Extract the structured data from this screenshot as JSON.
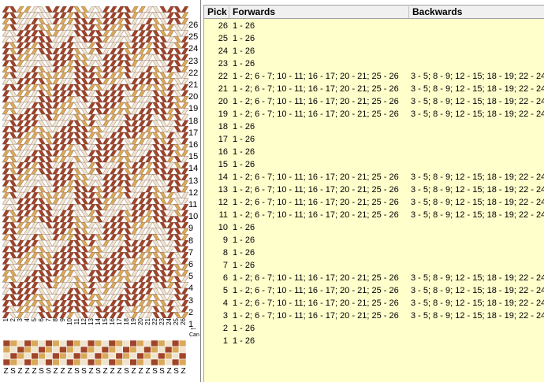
{
  "colors": {
    "rust": "#a0442a",
    "gold": "#d9a95a",
    "cream": "#efe4cf",
    "table_bg": "#ffffcc",
    "header_bg": "#f0f0f0"
  },
  "table": {
    "headers": {
      "pick": "Pick",
      "forwards": "Forwards",
      "backwards": "Backwards"
    },
    "rows": [
      {
        "pick": "26",
        "forwards": "1 - 26",
        "backwards": ""
      },
      {
        "pick": "25",
        "forwards": "1 - 26",
        "backwards": ""
      },
      {
        "pick": "24",
        "forwards": "1 - 26",
        "backwards": ""
      },
      {
        "pick": "23",
        "forwards": "1 - 26",
        "backwards": ""
      },
      {
        "pick": "22",
        "forwards": "1 - 2; 6 - 7; 10 - 11; 16 - 17; 20 - 21; 25 - 26",
        "backwards": "3 - 5; 8 - 9; 12 - 15; 18 - 19; 22 - 24"
      },
      {
        "pick": "21",
        "forwards": "1 - 2; 6 - 7; 10 - 11; 16 - 17; 20 - 21; 25 - 26",
        "backwards": "3 - 5; 8 - 9; 12 - 15; 18 - 19; 22 - 24"
      },
      {
        "pick": "20",
        "forwards": "1 - 2; 6 - 7; 10 - 11; 16 - 17; 20 - 21; 25 - 26",
        "backwards": "3 - 5; 8 - 9; 12 - 15; 18 - 19; 22 - 24"
      },
      {
        "pick": "19",
        "forwards": "1 - 2; 6 - 7; 10 - 11; 16 - 17; 20 - 21; 25 - 26",
        "backwards": "3 - 5; 8 - 9; 12 - 15; 18 - 19; 22 - 24"
      },
      {
        "pick": "18",
        "forwards": "1 - 26",
        "backwards": ""
      },
      {
        "pick": "17",
        "forwards": "1 - 26",
        "backwards": ""
      },
      {
        "pick": "16",
        "forwards": "1 - 26",
        "backwards": ""
      },
      {
        "pick": "15",
        "forwards": "1 - 26",
        "backwards": ""
      },
      {
        "pick": "14",
        "forwards": "1 - 2; 6 - 7; 10 - 11; 16 - 17; 20 - 21; 25 - 26",
        "backwards": "3 - 5; 8 - 9; 12 - 15; 18 - 19; 22 - 24"
      },
      {
        "pick": "13",
        "forwards": "1 - 2; 6 - 7; 10 - 11; 16 - 17; 20 - 21; 25 - 26",
        "backwards": "3 - 5; 8 - 9; 12 - 15; 18 - 19; 22 - 24"
      },
      {
        "pick": "12",
        "forwards": "1 - 2; 6 - 7; 10 - 11; 16 - 17; 20 - 21; 25 - 26",
        "backwards": "3 - 5; 8 - 9; 12 - 15; 18 - 19; 22 - 24"
      },
      {
        "pick": "11",
        "forwards": "1 - 2; 6 - 7; 10 - 11; 16 - 17; 20 - 21; 25 - 26",
        "backwards": "3 - 5; 8 - 9; 12 - 15; 18 - 19; 22 - 24"
      },
      {
        "pick": "10",
        "forwards": "1 - 26",
        "backwards": ""
      },
      {
        "pick": "9",
        "forwards": "1 - 26",
        "backwards": ""
      },
      {
        "pick": "8",
        "forwards": "1 - 26",
        "backwards": ""
      },
      {
        "pick": "7",
        "forwards": "1 - 26",
        "backwards": ""
      },
      {
        "pick": "6",
        "forwards": "1 - 2; 6 - 7; 10 - 11; 16 - 17; 20 - 21; 25 - 26",
        "backwards": "3 - 5; 8 - 9; 12 - 15; 18 - 19; 22 - 24"
      },
      {
        "pick": "5",
        "forwards": "1 - 2; 6 - 7; 10 - 11; 16 - 17; 20 - 21; 25 - 26",
        "backwards": "3 - 5; 8 - 9; 12 - 15; 18 - 19; 22 - 24"
      },
      {
        "pick": "4",
        "forwards": "1 - 2; 6 - 7; 10 - 11; 16 - 17; 20 - 21; 25 - 26",
        "backwards": "3 - 5; 8 - 9; 12 - 15; 18 - 19; 22 - 24"
      },
      {
        "pick": "3",
        "forwards": "1 - 2; 6 - 7; 10 - 11; 16 - 17; 20 - 21; 25 - 26",
        "backwards": "3 - 5; 8 - 9; 12 - 15; 18 - 19; 22 - 24"
      },
      {
        "pick": "2",
        "forwards": "1 - 26",
        "backwards": ""
      },
      {
        "pick": "1",
        "forwards": "1 - 26",
        "backwards": ""
      }
    ]
  },
  "pattern": {
    "pick_numbers": [
      "26",
      "25",
      "24",
      "23",
      "22",
      "21",
      "20",
      "19",
      "18",
      "17",
      "16",
      "15",
      "14",
      "13",
      "12",
      "11",
      "10",
      "9",
      "8",
      "7",
      "6",
      "5",
      "4",
      "3",
      "2",
      "1"
    ],
    "card_numbers": [
      "1",
      "2",
      "3",
      "4",
      "5",
      "6",
      "7",
      "8",
      "9",
      "10",
      "11",
      "12",
      "13",
      "14",
      "15",
      "16",
      "17",
      "18",
      "19",
      "20",
      "21",
      "22",
      "23",
      "24",
      "25",
      "26"
    ],
    "direction_arrow": "←",
    "can_label": "Can",
    "twists": [
      "Z",
      "S",
      "Z",
      "Z",
      "Z",
      "S",
      "S",
      "Z",
      "Z",
      "Z",
      "S",
      "S",
      "Z",
      "S",
      "Z",
      "Z",
      "Z",
      "S",
      "Z",
      "Z",
      "Z",
      "S",
      "S",
      "Z",
      "S",
      "Z"
    ]
  }
}
